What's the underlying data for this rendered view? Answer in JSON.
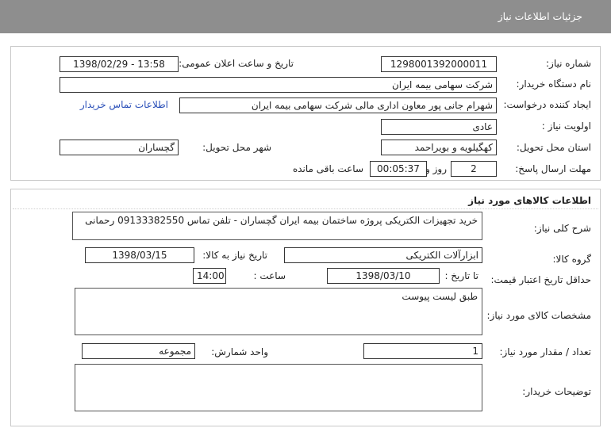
{
  "header": {
    "title": "جزئیات اطلاعات نیاز"
  },
  "info": {
    "need_number_label": "شماره نیاز:",
    "need_number": "1298001392000011",
    "announce_label": "تاریخ و ساعت اعلان عمومی:",
    "announce_value": "1398/02/29 - 13:58",
    "buyer_label": "نام دستگاه خریدار:",
    "buyer_value": "شرکت سهامی بیمه ایران",
    "creator_label": "ایجاد کننده درخواست:",
    "creator_value": "شهرام جانی پور معاون اداری مالی شرکت سهامی بیمه ایران",
    "contact_link": "اطلاعات تماس خریدار",
    "priority_label": "اولویت نیاز :",
    "priority_value": "عادی",
    "province_label": "استان محل تحویل:",
    "province_value": "کهگیلویه و بویراحمد",
    "city_label": "شهر محل تحویل:",
    "city_value": "گچساران",
    "deadline_label": "مهلت ارسال پاسخ:",
    "days_value": "2",
    "days_label": "روز و",
    "time_value": "00:05:37",
    "remaining_label": "ساعت باقی مانده"
  },
  "goods": {
    "section_title": "اطلاعات کالاهای مورد نیاز",
    "desc_label": "شرح کلی نیاز:",
    "desc_value": "خرید تجهیزات الکتریکی  پروژه ساختمان بیمه ایران گچساران - تلفن تماس 09133382550  رحمانی",
    "group_label": "گروه کالا:",
    "group_value": "ابزارآلات الکتریکی",
    "need_date_label": "تاریخ نیاز به کالا:",
    "need_date_value": "1398/03/15",
    "validity_label": "حداقل تاریخ اعتبار قیمت:",
    "to_date_label": "تا تاریخ :",
    "to_date_value": "1398/03/10",
    "hour_label": "ساعت :",
    "hour_value": "14:00",
    "spec_label": "مشخصات کالای مورد نیاز:",
    "spec_value": "طبق لیست پیوست",
    "qty_label": "تعداد / مقدار مورد نیاز:",
    "qty_value": "1",
    "unit_label": "واحد شمارش:",
    "unit_value": "مجموعه",
    "buyer_notes_label": "توضیحات خریدار:",
    "buyer_notes_value": ""
  }
}
